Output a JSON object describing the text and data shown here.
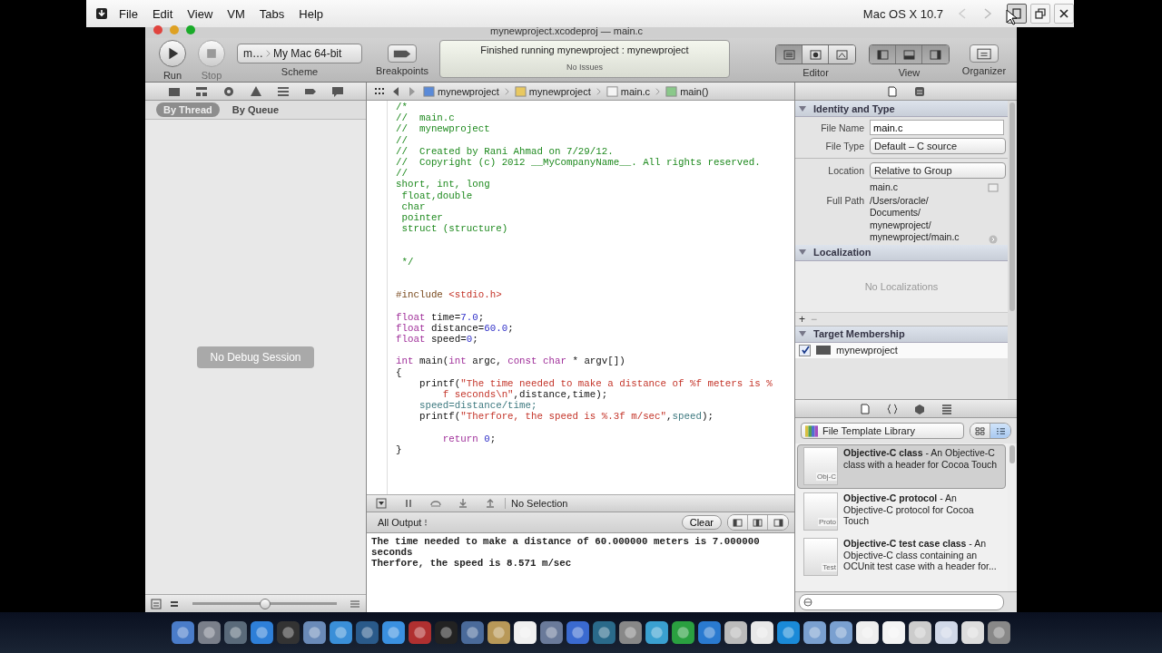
{
  "host_bar": {
    "menu": [
      "File",
      "Edit",
      "View",
      "VM",
      "Tabs",
      "Help"
    ],
    "title": "Mac OS X 10.7",
    "window_buttons": [
      {
        "selected": true
      },
      {
        "selected": false
      },
      {
        "selected": false
      }
    ]
  },
  "window": {
    "title": "mynewproject.xcodeproj — main.c"
  },
  "toolbar": {
    "run": "Run",
    "stop": {
      "label": "Stop",
      "disabled": true
    },
    "scheme": {
      "target": "m…",
      "destination": "My Mac 64-bit",
      "label": "Scheme"
    },
    "breakpoints": "Breakpoints",
    "status": {
      "message": "Finished running mynewproject : mynewproject",
      "issues": "No Issues"
    },
    "editor": {
      "label": "Editor",
      "modes": [
        {
          "selected": true
        },
        {
          "selected": false
        },
        {
          "selected": false
        }
      ]
    },
    "view": {
      "label": "View",
      "panes": [
        {
          "selected": true
        },
        {
          "selected": true
        },
        {
          "selected": true
        }
      ]
    },
    "organizer": "Organizer"
  },
  "debug_navigator": {
    "filters": [
      {
        "label": "By Thread",
        "selected": true
      },
      {
        "label": "By Queue",
        "selected": false
      }
    ],
    "empty_message": "No Debug Session",
    "zoom_slider": {
      "level": 0.5
    }
  },
  "jump_bar": {
    "path": [
      {
        "kind": "project",
        "label": "mynewproject"
      },
      {
        "kind": "folder",
        "label": "mynewproject"
      },
      {
        "kind": "file",
        "label": "main.c"
      },
      {
        "kind": "function",
        "label": "main()"
      }
    ]
  },
  "code": [
    {
      "kind": "code",
      "tokens": [
        {
          "kind": "comment",
          "text": "/*"
        }
      ]
    },
    {
      "kind": "code",
      "tokens": [
        {
          "kind": "comment",
          "text": "//  main.c"
        }
      ]
    },
    {
      "kind": "code",
      "tokens": [
        {
          "kind": "comment",
          "text": "//  mynewproject"
        }
      ]
    },
    {
      "kind": "code",
      "tokens": [
        {
          "kind": "comment",
          "text": "//"
        }
      ]
    },
    {
      "kind": "code",
      "tokens": [
        {
          "kind": "comment",
          "text": "//  Created by Rani Ahmad on 7/29/12."
        }
      ]
    },
    {
      "kind": "code",
      "tokens": [
        {
          "kind": "comment",
          "text": "//  Copyright (c) 2012 __MyCompanyName__. All rights reserved."
        }
      ]
    },
    {
      "kind": "code",
      "tokens": [
        {
          "kind": "comment",
          "text": "//"
        }
      ]
    },
    {
      "kind": "code",
      "tokens": [
        {
          "kind": "comment",
          "text": "short, int, long"
        }
      ]
    },
    {
      "kind": "code",
      "tokens": [
        {
          "kind": "comment",
          "text": " float,double"
        }
      ]
    },
    {
      "kind": "code",
      "tokens": [
        {
          "kind": "comment",
          "text": " char"
        }
      ]
    },
    {
      "kind": "code",
      "tokens": [
        {
          "kind": "comment",
          "text": " pointer"
        }
      ]
    },
    {
      "kind": "code",
      "tokens": [
        {
          "kind": "comment",
          "text": " struct (structure)"
        }
      ]
    },
    {
      "kind": "blank"
    },
    {
      "kind": "blank"
    },
    {
      "kind": "code",
      "tokens": [
        {
          "kind": "comment",
          "text": " */"
        }
      ]
    },
    {
      "kind": "blank"
    },
    {
      "kind": "blank"
    },
    {
      "kind": "code",
      "tokens": [
        {
          "kind": "preprocessor",
          "text": "#include "
        },
        {
          "kind": "string",
          "text": "<stdio.h>"
        }
      ]
    },
    {
      "kind": "blank"
    },
    {
      "kind": "code",
      "tokens": [
        {
          "kind": "keyword",
          "text": "float"
        },
        {
          "kind": "plain",
          "text": " time="
        },
        {
          "kind": "number",
          "text": "7.0"
        },
        {
          "kind": "plain",
          "text": ";"
        }
      ]
    },
    {
      "kind": "code",
      "tokens": [
        {
          "kind": "keyword",
          "text": "float"
        },
        {
          "kind": "plain",
          "text": " distance="
        },
        {
          "kind": "number",
          "text": "60.0"
        },
        {
          "kind": "plain",
          "text": ";"
        }
      ]
    },
    {
      "kind": "code",
      "tokens": [
        {
          "kind": "keyword",
          "text": "float"
        },
        {
          "kind": "plain",
          "text": " speed="
        },
        {
          "kind": "number",
          "text": "0"
        },
        {
          "kind": "plain",
          "text": ";"
        }
      ]
    },
    {
      "kind": "blank"
    },
    {
      "kind": "code",
      "tokens": [
        {
          "kind": "keyword",
          "text": "int"
        },
        {
          "kind": "plain",
          "text": " main("
        },
        {
          "kind": "keyword",
          "text": "int"
        },
        {
          "kind": "plain",
          "text": " argc, "
        },
        {
          "kind": "keyword",
          "text": "const char"
        },
        {
          "kind": "plain",
          "text": " * argv[])"
        }
      ]
    },
    {
      "kind": "code",
      "tokens": [
        {
          "kind": "plain",
          "text": "{"
        }
      ]
    },
    {
      "kind": "code",
      "tokens": [
        {
          "kind": "plain",
          "text": "    printf("
        },
        {
          "kind": "string",
          "text": "\"The time needed to make a distance of %f meters is %"
        }
      ]
    },
    {
      "kind": "code",
      "tokens": [
        {
          "kind": "string",
          "text": "        f seconds\\n\""
        },
        {
          "kind": "plain",
          "text": ",distance,time);"
        }
      ]
    },
    {
      "kind": "code",
      "tokens": [
        {
          "kind": "variable",
          "text": "    speed=distance/time;"
        }
      ]
    },
    {
      "kind": "code",
      "tokens": [
        {
          "kind": "plain",
          "text": "    printf("
        },
        {
          "kind": "string",
          "text": "\"Therfore, the speed is %.3f m/sec\""
        },
        {
          "kind": "plain",
          "text": ","
        },
        {
          "kind": "variable",
          "text": "speed"
        },
        {
          "kind": "plain",
          "text": ");"
        }
      ]
    },
    {
      "kind": "blank"
    },
    {
      "kind": "code",
      "tokens": [
        {
          "kind": "keyword",
          "text": "        return "
        },
        {
          "kind": "number",
          "text": "0"
        },
        {
          "kind": "plain",
          "text": ";"
        }
      ]
    },
    {
      "kind": "code",
      "tokens": [
        {
          "kind": "plain",
          "text": "}"
        }
      ]
    }
  ],
  "debug_bar": {
    "selection": "No Selection"
  },
  "console": {
    "filter": "All Output ⁝",
    "clear": "Clear",
    "output": [
      "The time needed to make a distance of 60.000000 meters is 7.000000",
      "seconds",
      "Therfore, the speed is 8.571 m/sec"
    ]
  },
  "inspector": {
    "identity": {
      "title": "Identity and Type",
      "expanded": true,
      "file_name_label": "File Name",
      "file_name": "main.c",
      "file_type_label": "File Type",
      "file_type": "Default – C source",
      "location_label": "Location",
      "location": "Relative to Group",
      "relative_name": "main.c",
      "full_path_label": "Full Path",
      "full_path": [
        "/Users/oracle/",
        "Documents/",
        "mynewproject/",
        "mynewproject/main.c"
      ]
    },
    "localization": {
      "title": "Localization",
      "expanded": true,
      "empty": "No Localizations",
      "add": "+",
      "remove": "−"
    },
    "target_membership": {
      "title": "Target Membership",
      "expanded": true,
      "targets": [
        {
          "name": "mynewproject",
          "checked": true
        }
      ]
    }
  },
  "library": {
    "selector": "File Template Library",
    "view_modes": [
      {
        "selected": false
      },
      {
        "selected": true
      }
    ],
    "items": [
      {
        "badge": "Obj-C",
        "text": "**Objective-C class** - An Objective-C class with a header for Cocoa Touch",
        "selected": true
      },
      {
        "badge": "Proto",
        "text": "**Objective-C protocol** - An Objective-C protocol for Cocoa Touch",
        "selected": false
      },
      {
        "badge": "Test",
        "text": "**Objective-C test case class** - An Objective-C class containing an OCUnit test case with a header for...",
        "selected": false
      }
    ]
  }
}
